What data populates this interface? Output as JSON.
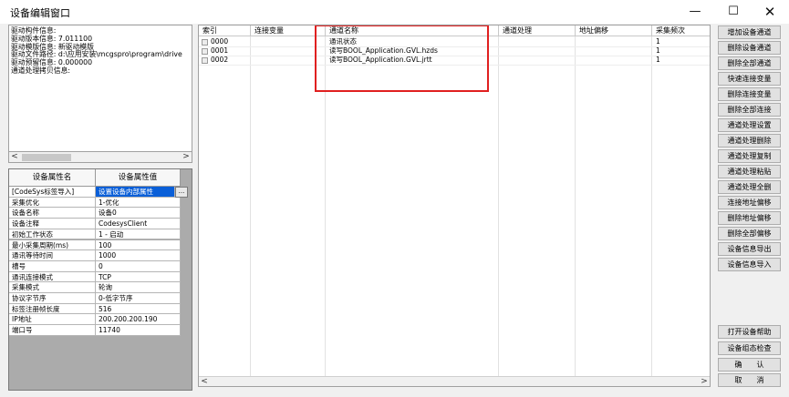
{
  "window": {
    "title": "设备编辑窗口",
    "min_glyph": "—",
    "max_glyph": "☐",
    "close_glyph": "✕"
  },
  "info_panel": {
    "lines": [
      "驱动构件信息:",
      "驱动版本信息: 7.011100",
      "驱动模版信息: 新驱动模版",
      "驱动文件路径: d:\\应用安装\\mcgspro\\program\\drive",
      "驱动预留信息: 0.000000",
      "通道处理拷贝信息:"
    ],
    "scroll_left": "<",
    "scroll_right": ">"
  },
  "property_table": {
    "header_name": "设备属性名",
    "header_value": "设备属性值",
    "button_label": "...",
    "rows": [
      {
        "name": "[CodeSys标签导入]",
        "value": "设置设备内部属性"
      },
      {
        "name": "采集优化",
        "value": "1-优化"
      },
      {
        "name": "设备名称",
        "value": "设备0"
      },
      {
        "name": "设备注释",
        "value": "CodesysClient"
      },
      {
        "name": "初始工作状态",
        "value": "1 - 启动"
      },
      {
        "name": "最小采集周期(ms)",
        "value": "100"
      },
      {
        "name": "通讯等待时间",
        "value": "1000"
      },
      {
        "name": "槽号",
        "value": "0"
      },
      {
        "name": "通讯连接模式",
        "value": "TCP"
      },
      {
        "name": "采集模式",
        "value": "轮询"
      },
      {
        "name": "协议字节序",
        "value": "0-低字节序"
      },
      {
        "name": "标签注册帧长度",
        "value": "516"
      },
      {
        "name": "IP地址",
        "value": "200.200.200.190"
      },
      {
        "name": "端口号",
        "value": "11740"
      }
    ]
  },
  "channel_grid": {
    "columns": [
      "索引",
      "连接变量",
      "通道名称",
      "通道处理",
      "地址偏移",
      "采集频次"
    ],
    "rows": [
      {
        "index": "0000",
        "variable": "",
        "name": "通讯状态",
        "processing": "",
        "offset": "",
        "frequency": "1"
      },
      {
        "index": "0001",
        "variable": "",
        "name": "读写BOOL_Application.GVL.hzds",
        "processing": "",
        "offset": "",
        "frequency": "1"
      },
      {
        "index": "0002",
        "variable": "",
        "name": "读写BOOL_Application.GVL.jrtt",
        "processing": "",
        "offset": "",
        "frequency": "1"
      }
    ],
    "scroll_left": "<",
    "scroll_right": ">"
  },
  "side_buttons": {
    "top": [
      "增加设备通道",
      "删除设备通道",
      "删除全部通道",
      "快速连接变量",
      "删除连接变量",
      "删除全部连接",
      "通道处理设置",
      "通道处理删除",
      "通道处理复制",
      "通道处理粘贴",
      "通道处理全删",
      "连接地址偏移",
      "删除地址偏移",
      "删除全部偏移",
      "设备信息导出",
      "设备信息导入"
    ],
    "bottom": [
      "打开设备帮助",
      "设备组态检查",
      "确　　认",
      "取　　消"
    ]
  },
  "colors": {
    "selection": "#0a5fd8",
    "highlight_box": "#e02020"
  }
}
